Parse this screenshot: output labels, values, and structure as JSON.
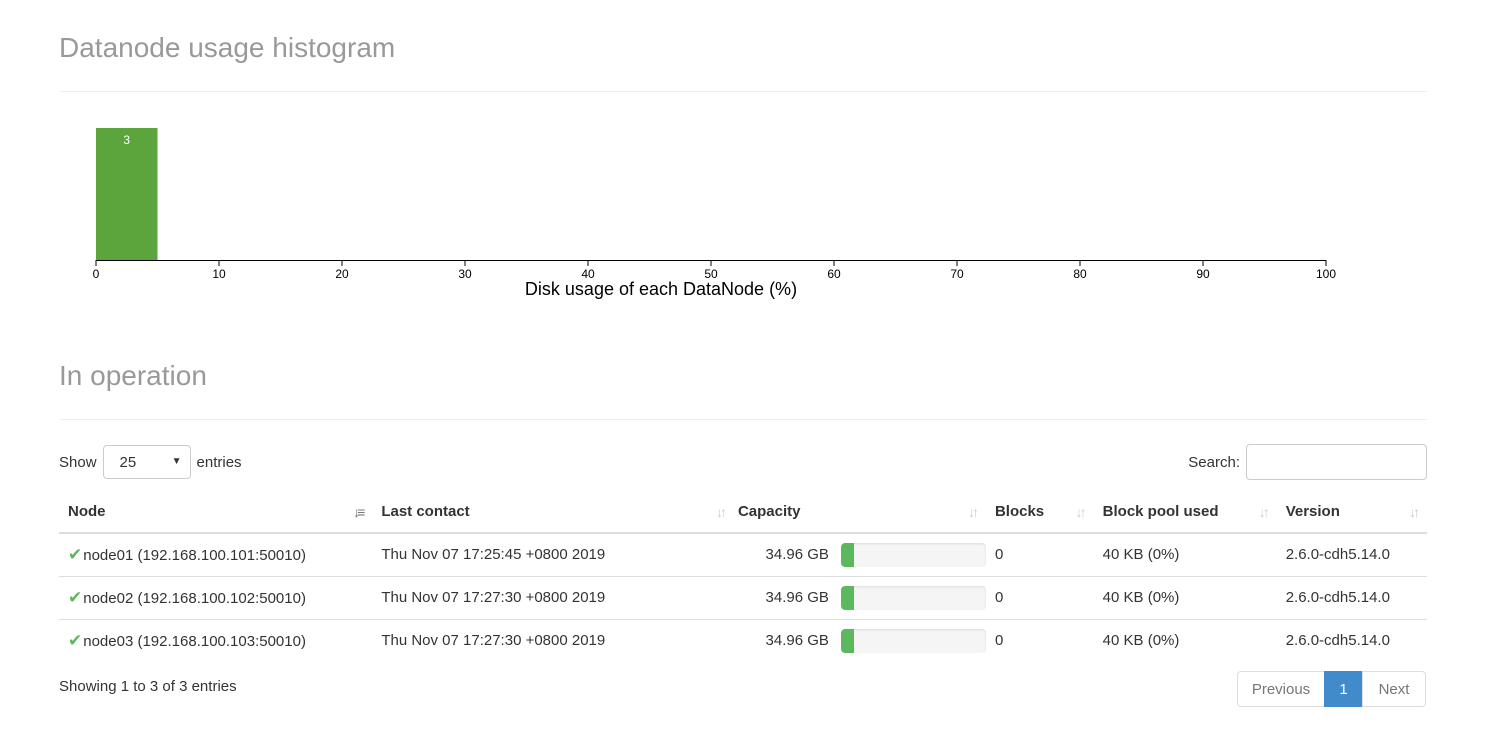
{
  "histogram": {
    "title": "Datanode usage histogram"
  },
  "chart_data": {
    "type": "bar",
    "x": [
      0,
      5
    ],
    "values": [
      3
    ],
    "bins": [
      {
        "from": 0,
        "to": 5,
        "count": 3
      }
    ],
    "xlabel": "Disk usage of each DataNode (%)",
    "ylabel": "",
    "xlim": [
      0,
      100
    ],
    "xticks": [
      "0",
      "10",
      "20",
      "30",
      "40",
      "50",
      "60",
      "70",
      "80",
      "90",
      "100"
    ],
    "bar_color": "#5ca53d"
  },
  "operation": {
    "title": "In operation",
    "show_label": "Show",
    "entries_value": "25",
    "entries_label": "entries",
    "search_label": "Search:",
    "search_value": "",
    "columns": [
      "Node",
      "Last contact",
      "Capacity",
      "Blocks",
      "Block pool used",
      "Version"
    ],
    "rows": [
      {
        "node": "node01 (192.168.100.101:50010)",
        "last_contact": "Thu Nov 07 17:25:45 +0800 2019",
        "capacity": "34.96 GB",
        "capacity_used_pct": 1,
        "blocks": "0",
        "block_pool_used": "40 KB (0%)",
        "version": "2.6.0-cdh5.14.0"
      },
      {
        "node": "node02 (192.168.100.102:50010)",
        "last_contact": "Thu Nov 07 17:27:30 +0800 2019",
        "capacity": "34.96 GB",
        "capacity_used_pct": 1,
        "blocks": "0",
        "block_pool_used": "40 KB (0%)",
        "version": "2.6.0-cdh5.14.0"
      },
      {
        "node": "node03 (192.168.100.103:50010)",
        "last_contact": "Thu Nov 07 17:27:30 +0800 2019",
        "capacity": "34.96 GB",
        "capacity_used_pct": 1,
        "blocks": "0",
        "block_pool_used": "40 KB (0%)",
        "version": "2.6.0-cdh5.14.0"
      }
    ],
    "info": "Showing 1 to 3 of 3 entries",
    "pagination": {
      "previous": "Previous",
      "current": "1",
      "next": "Next"
    }
  },
  "colors": {
    "status_ok": "#5cb85c",
    "page_active": "#428bca",
    "title_gray": "#999999"
  },
  "icons": {
    "status": "check-icon",
    "sort_active": "sort-asc-icon",
    "sort_inactive": "sort-both-icon"
  }
}
